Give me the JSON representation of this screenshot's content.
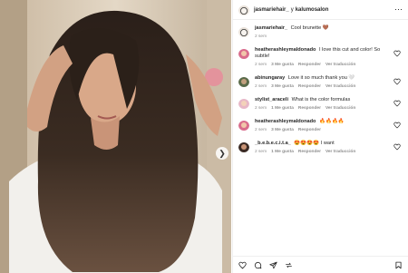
{
  "post": {
    "author": "jasmariehair_",
    "joiner": "y",
    "collaborator": "kalumosalon"
  },
  "photo": {
    "alt_icon": "next-photo-arrow"
  },
  "comments": [
    {
      "user": "jasmariehair_",
      "text": "Cool brunette 🤎",
      "time": "2 sem",
      "likes": "",
      "reply": "",
      "translate": ""
    },
    {
      "user": "heatherashleymaldonado",
      "text": "I love this cut and color! So subtle!",
      "time": "2 sem",
      "likes": "3 Me gusta",
      "reply": "Responder",
      "translate": "Ver traducción"
    },
    {
      "user": "abinungaray",
      "text": "Love it so much thank you 🤍",
      "time": "2 sem",
      "likes": "3 Me gusta",
      "reply": "Responder",
      "translate": "Ver traducción"
    },
    {
      "user": "stylist_araceli",
      "text": "What is the color formulas",
      "time": "2 sem",
      "likes": "1 Me gusta",
      "reply": "Responder",
      "translate": "Ver traducción"
    },
    {
      "user": "heatherashleymaldonado",
      "text": "🔥🔥🔥🔥",
      "time": "2 sem",
      "likes": "3 Me gusta",
      "reply": "Responder",
      "translate": ""
    },
    {
      "user": "_b.e.b.e.c.i.t.a_",
      "text": "😍😍😍😍 I want",
      "time": "2 sem",
      "likes": "1 Me gusta",
      "reply": "Responder",
      "translate": "Ver traducción"
    }
  ],
  "colors": {
    "text": "#262626",
    "muted": "#8e8e8e",
    "border": "#efefef"
  }
}
